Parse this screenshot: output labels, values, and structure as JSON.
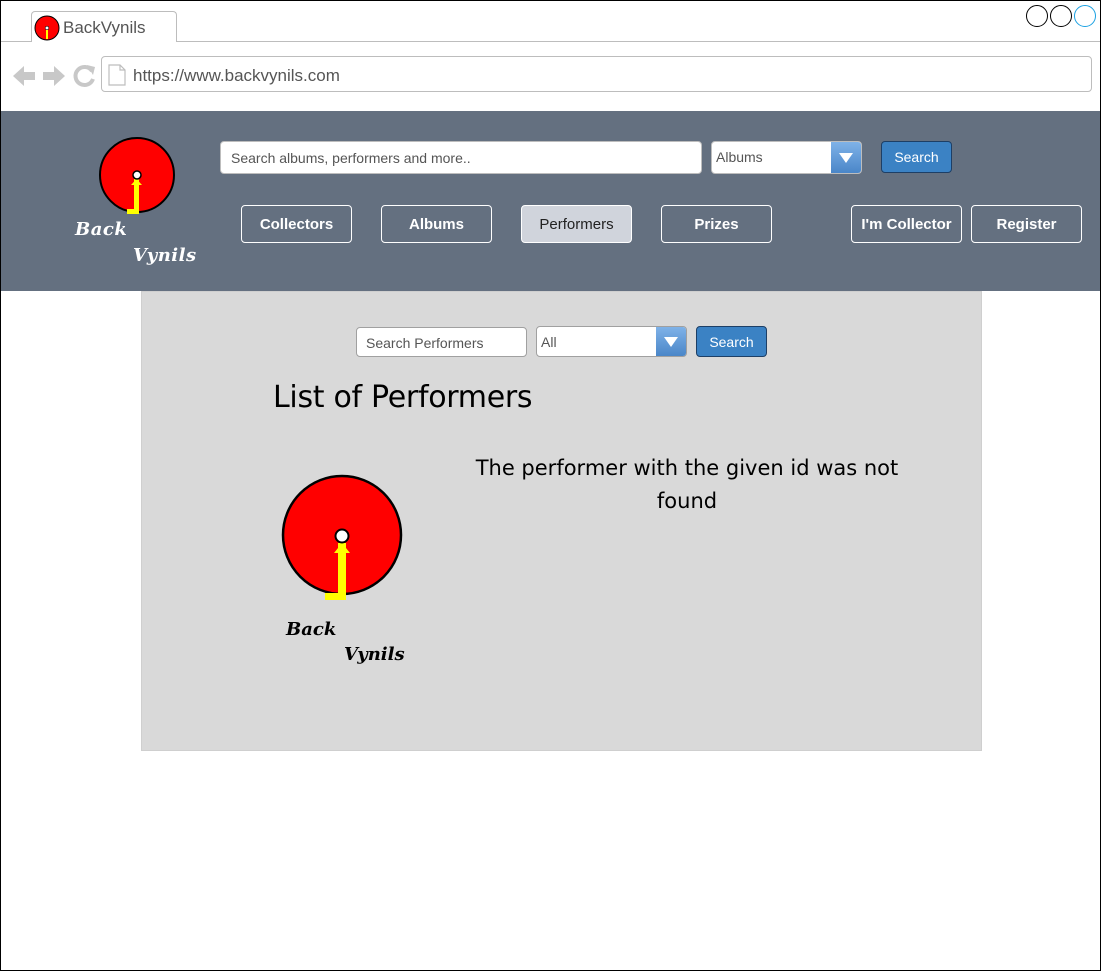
{
  "browser": {
    "tab_title": "BackVynils",
    "url": "https://www.backvynils.com"
  },
  "header": {
    "logo_text_line1": "Back",
    "logo_text_line2": "Vynils",
    "search_placeholder": "Search albums, performers and more..",
    "category_select": "Albums",
    "search_button": "Search",
    "nav": [
      {
        "label": "Collectors"
      },
      {
        "label": "Albums"
      },
      {
        "label": "Performers"
      },
      {
        "label": "Prizes"
      }
    ],
    "collector_button": "I'm Collector",
    "register_button": "Register"
  },
  "main": {
    "search_placeholder": "Search Performers",
    "filter_select": "All",
    "search_button": "Search",
    "title": "List of Performers",
    "logo_text_line1": "Back",
    "logo_text_line2": "Vynils",
    "message": "The performer with the given id was not found"
  },
  "colors": {
    "header_bg": "#647080",
    "panel_bg": "#d9d9d9",
    "accent_blue": "#3b82c4",
    "logo_red": "#ff0000",
    "logo_yellow": "#ffff00"
  }
}
